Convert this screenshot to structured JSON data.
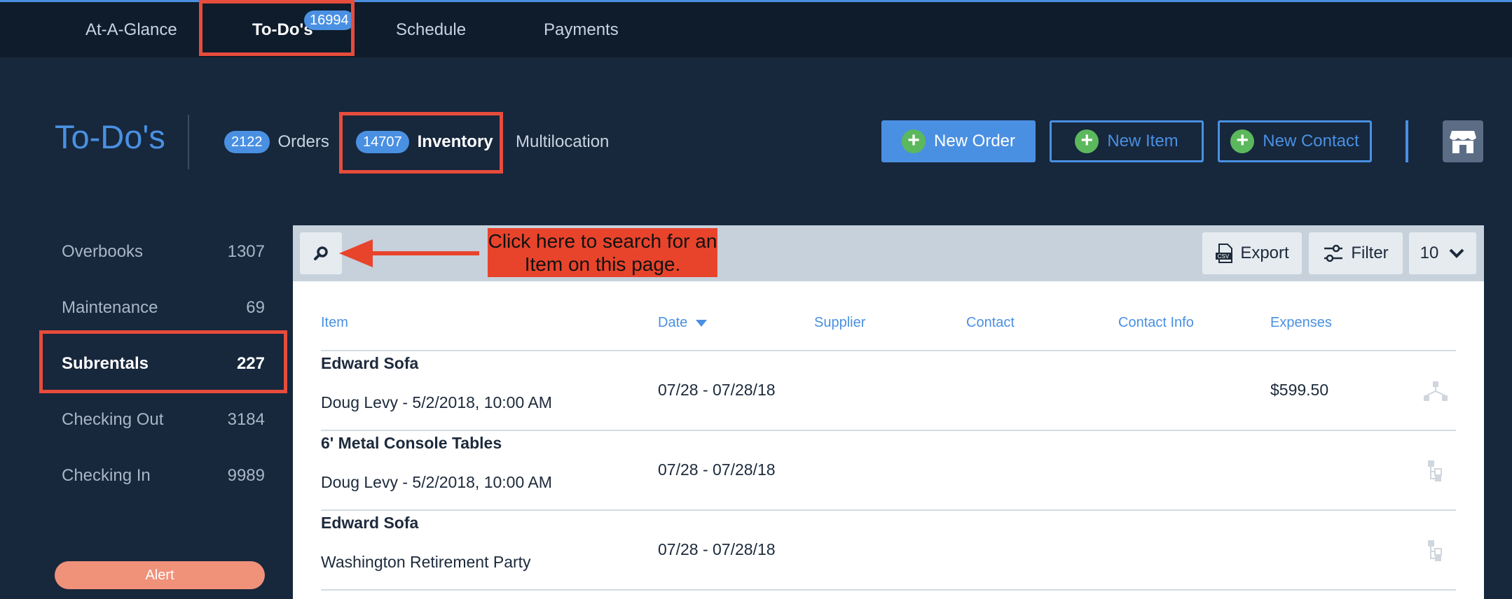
{
  "topnav": {
    "tabs": [
      {
        "label": "At-A-Glance"
      },
      {
        "label": "To-Do's",
        "badge": "16994"
      },
      {
        "label": "Schedule"
      },
      {
        "label": "Payments"
      }
    ]
  },
  "header": {
    "title": "To-Do's",
    "subtabs": [
      {
        "count": "2122",
        "label": "Orders"
      },
      {
        "count": "14707",
        "label": "Inventory"
      },
      {
        "label": "Multilocation"
      }
    ],
    "buttons": {
      "new_order": "New Order",
      "new_item": "New Item",
      "new_contact": "New Contact"
    }
  },
  "sidebar": {
    "items": [
      {
        "label": "Overbooks",
        "count": "1307"
      },
      {
        "label": "Maintenance",
        "count": "69"
      },
      {
        "label": "Subrentals",
        "count": "227"
      },
      {
        "label": "Checking Out",
        "count": "3184"
      },
      {
        "label": "Checking In",
        "count": "9989"
      }
    ],
    "alert_label": "Alert"
  },
  "toolbar": {
    "export_label": "Export",
    "filter_label": "Filter",
    "per_page": "10",
    "callout": "Click here to search for an Item on this page."
  },
  "table": {
    "columns": [
      "Item",
      "Date",
      "Supplier",
      "Contact",
      "Contact Info",
      "Expenses"
    ],
    "rows": [
      {
        "item": "Edward Sofa",
        "sub": "Doug Levy - 5/2/2018, 10:00 AM",
        "date": "07/28 - 07/28/18",
        "expenses": "$599.50"
      },
      {
        "item": "6' Metal Console Tables",
        "sub": "Doug Levy - 5/2/2018, 10:00 AM",
        "date": "07/28 - 07/28/18",
        "expenses": ""
      },
      {
        "item": "Edward Sofa",
        "sub": "Washington Retirement Party",
        "date": "07/28 - 07/28/18",
        "expenses": ""
      }
    ]
  },
  "colors": {
    "accent": "#4a90e2",
    "background": "#17273c",
    "highlight_box": "#e74c3c",
    "add_green": "#5cb85c"
  }
}
